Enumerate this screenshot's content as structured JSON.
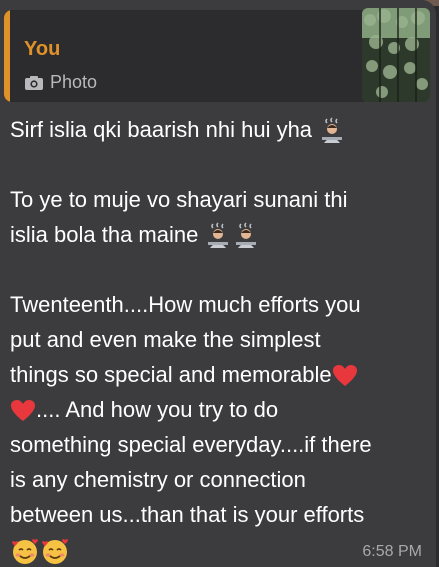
{
  "reply": {
    "sender": "You",
    "media_label": "Photo",
    "media_icon": "camera-icon"
  },
  "message": {
    "p1_l1": "Sirf islia qki baarish nhi hui yha",
    "p2_l1": "To ye to muje vo shayari sunani thi",
    "p2_l2": "islia bola tha maine",
    "p3_l1": "Twenteenth....How much efforts you",
    "p3_l2": "put and even make the simplest",
    "p3_l3": "things so special and memorable",
    "p3_l4": ".... And how you try to do",
    "p3_l5": "something special everyday....if there",
    "p3_l6": "is any chemistry or connection",
    "p3_l7": "between us...than that is your efforts",
    "time": "6:58 PM"
  },
  "colors": {
    "accent": "#e0922a",
    "bubble": "#3c3c3e",
    "quote_bg": "#2c2c2e",
    "text": "#ffffff",
    "muted": "#a8a8ad"
  }
}
